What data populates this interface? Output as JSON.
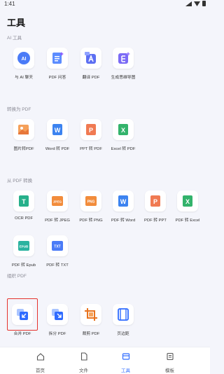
{
  "status": {
    "time": "1:41"
  },
  "title": "工具",
  "sections": [
    {
      "title": "AI 工具",
      "items": [
        {
          "label": "与 AI 聊天",
          "icon": "ai-chat-icon"
        },
        {
          "label": "PDF 问答",
          "icon": "pdf-qa-icon"
        },
        {
          "label": "翻译 PDF",
          "icon": "translate-pdf-icon"
        },
        {
          "label": "生成思维导图",
          "icon": "mindmap-icon"
        }
      ]
    },
    {
      "title": "转换为 PDF",
      "items": [
        {
          "label": "图片转PDF",
          "icon": "image-to-pdf-icon"
        },
        {
          "label": "Word 转 PDF",
          "icon": "word-to-pdf-icon"
        },
        {
          "label": "PPT 转 PDF",
          "icon": "ppt-to-pdf-icon"
        },
        {
          "label": "Excel 转 PDF",
          "icon": "excel-to-pdf-icon"
        }
      ]
    },
    {
      "title": "从 PDF 转换",
      "items": [
        {
          "label": "OCR PDF",
          "icon": "ocr-pdf-icon"
        },
        {
          "label": "PDF 转 JPEG",
          "icon": "pdf-to-jpeg-icon"
        },
        {
          "label": "PDF 转 PNG",
          "icon": "pdf-to-png-icon"
        },
        {
          "label": "PDF 转 Word",
          "icon": "pdf-to-word-icon"
        },
        {
          "label": "PDF 转 PPT",
          "icon": "pdf-to-ppt-icon"
        },
        {
          "label": "PDF 转 Excel",
          "icon": "pdf-to-excel-icon"
        },
        {
          "label": "PDF 转 Epub",
          "icon": "pdf-to-epub-icon"
        },
        {
          "label": "PDF 转 TXT",
          "icon": "pdf-to-txt-icon"
        }
      ]
    },
    {
      "title": "组织 PDF",
      "items": [
        {
          "label": "合并 PDF",
          "icon": "merge-pdf-icon"
        },
        {
          "label": "拆分 PDF",
          "icon": "split-pdf-icon"
        },
        {
          "label": "裁剪 PDF",
          "icon": "crop-pdf-icon"
        },
        {
          "label": "页边距",
          "icon": "margins-icon"
        }
      ]
    }
  ],
  "icon_text": {
    "ai": "AI",
    "jpeg": "JPEG",
    "png": "PNG",
    "epub": "EPUB",
    "txt": "TXT",
    "word": "W",
    "ppt": "P",
    "excel": "X",
    "ocr": "T"
  },
  "tabs": [
    {
      "label": "首页",
      "icon": "home-icon"
    },
    {
      "label": "文件",
      "icon": "file-icon"
    },
    {
      "label": "工具",
      "icon": "tools-icon",
      "active": true
    },
    {
      "label": "模板",
      "icon": "template-icon"
    }
  ],
  "colors": {
    "accent": "#2f6bff",
    "highlight": "#e5322d",
    "background": "#f4f5fb"
  }
}
